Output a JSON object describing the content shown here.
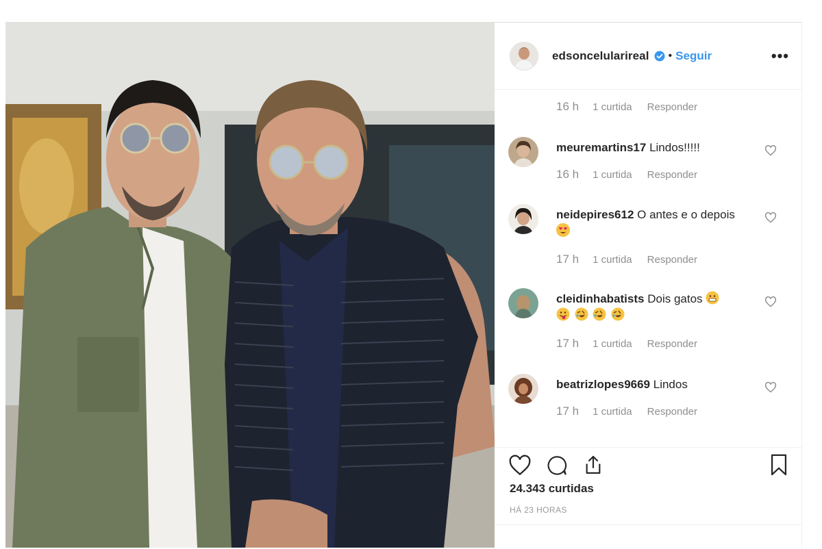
{
  "post": {
    "username": "edsoncelularireal",
    "separator": "•",
    "follow_label": "Seguir",
    "more_label": "•••"
  },
  "comments": [
    {
      "type": "meta-only",
      "time": "16 h",
      "likes": "1 curtida",
      "reply": "Responder"
    },
    {
      "username": "meuremartins17",
      "text": "Lindos!!!!!",
      "time": "16 h",
      "likes": "1 curtida",
      "reply": "Responder"
    },
    {
      "username": "neidepires612",
      "text": "O antes e o depois",
      "emojis": [
        "heart-eyes"
      ],
      "time": "17 h",
      "likes": "1 curtida",
      "reply": "Responder"
    },
    {
      "username": "cleidinhabatists",
      "text": "Dois gatos",
      "emojis": [
        "grin",
        "tongue",
        "rofl",
        "rofl",
        "rofl"
      ],
      "time": "17 h",
      "likes": "1 curtida",
      "reply": "Responder"
    },
    {
      "username": "beatrizlopes9669",
      "text": "Lindos",
      "time": "17 h",
      "likes": "1 curtida",
      "reply": "Responder"
    }
  ],
  "actions": {
    "icons": [
      "heart-icon",
      "comment-icon",
      "share-icon",
      "bookmark-icon"
    ],
    "likes_count": "24.343 curtidas",
    "time_ago": "HÁ 23 HORAS"
  },
  "colors": {
    "accent": "#3897f0",
    "text": "#262626",
    "muted": "#8e8e8e",
    "border": "#efefef"
  }
}
